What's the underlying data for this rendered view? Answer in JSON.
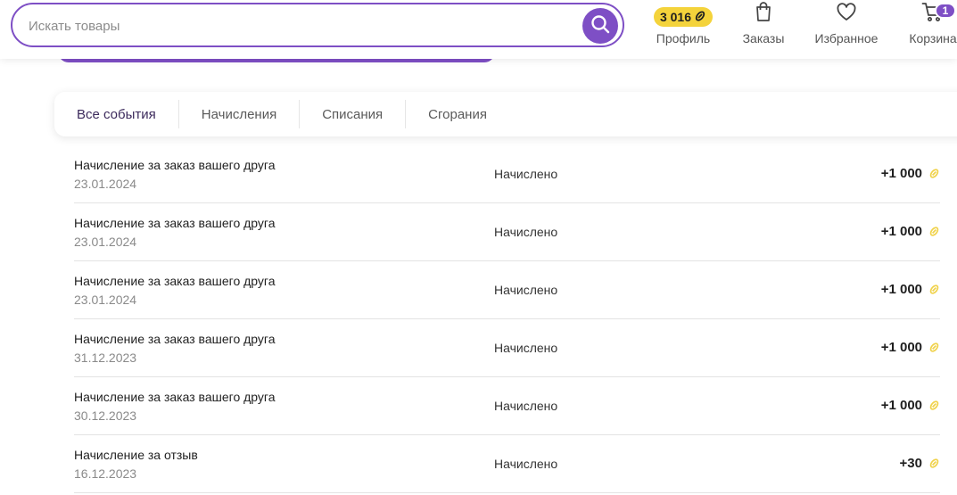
{
  "colors": {
    "accent": "#7e4fc5",
    "badge": "#f4d33b",
    "coin": "#f0d24a"
  },
  "search": {
    "placeholder": "Искать товары",
    "icon": "search-icon"
  },
  "header": {
    "profile": {
      "balance": "3 016",
      "label": "Профиль",
      "icon": "coin-icon"
    },
    "orders": {
      "label": "Заказы",
      "icon": "bag-icon"
    },
    "favorites": {
      "label": "Избранное",
      "icon": "heart-icon"
    },
    "cart": {
      "label": "Корзина",
      "count": "1",
      "icon": "cart-icon"
    }
  },
  "tabs": [
    {
      "label": "Все события",
      "active": true
    },
    {
      "label": "Начисления",
      "active": false
    },
    {
      "label": "Списания",
      "active": false
    },
    {
      "label": "Сгорания",
      "active": false
    }
  ],
  "transactions": [
    {
      "title": "Начисление за заказ вашего друга",
      "date": "23.01.2024",
      "status": "Начислено",
      "amount": "+1 000"
    },
    {
      "title": "Начисление за заказ вашего друга",
      "date": "23.01.2024",
      "status": "Начислено",
      "amount": "+1 000"
    },
    {
      "title": "Начисление за заказ вашего друга",
      "date": "23.01.2024",
      "status": "Начислено",
      "amount": "+1 000"
    },
    {
      "title": "Начисление за заказ вашего друга",
      "date": "31.12.2023",
      "status": "Начислено",
      "amount": "+1 000"
    },
    {
      "title": "Начисление за заказ вашего друга",
      "date": "30.12.2023",
      "status": "Начислено",
      "amount": "+1 000"
    },
    {
      "title": "Начисление за отзыв",
      "date": "16.12.2023",
      "status": "Начислено",
      "amount": "+30"
    }
  ]
}
